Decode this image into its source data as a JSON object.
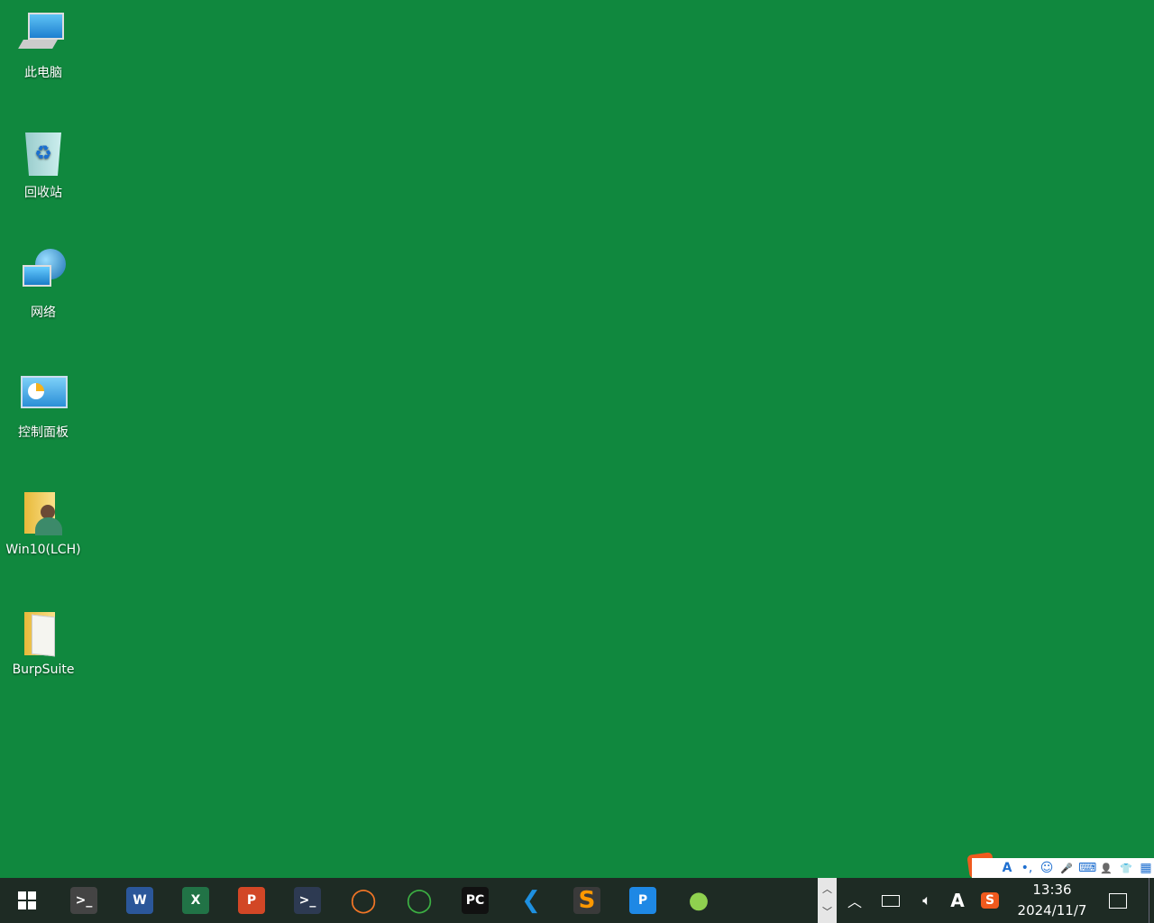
{
  "desktop": {
    "icons": [
      {
        "label": "此电脑",
        "icon": "computer-icon"
      },
      {
        "label": "回收站",
        "icon": "recycle-bin-icon"
      },
      {
        "label": "网络",
        "icon": "network-icon"
      },
      {
        "label": "控制面板",
        "icon": "control-panel-icon"
      },
      {
        "label": "Win10(LCH)",
        "icon": "user-folder-icon"
      },
      {
        "label": "BurpSuite",
        "icon": "folder-icon"
      }
    ]
  },
  "taskbar": {
    "apps": [
      {
        "name": "terminal-tool",
        "glyph": ">_",
        "color": "#444"
      },
      {
        "name": "word",
        "glyph": "W",
        "color": "#2b579a"
      },
      {
        "name": "excel",
        "glyph": "X",
        "color": "#217346"
      },
      {
        "name": "powerpoint",
        "glyph": "P",
        "color": "#d24726"
      },
      {
        "name": "powershell",
        "glyph": ">_",
        "color": "#2d3a52"
      },
      {
        "name": "jupyter",
        "glyph": "◯",
        "color": "transparent"
      },
      {
        "name": "circle-app",
        "glyph": "◯",
        "color": "transparent"
      },
      {
        "name": "pycharm",
        "glyph": "PC",
        "color": "#111"
      },
      {
        "name": "vscode",
        "glyph": "❮",
        "color": "transparent"
      },
      {
        "name": "sublime",
        "glyph": "S",
        "color": "#3a3a3a"
      },
      {
        "name": "p-app",
        "glyph": "P",
        "color": "#1e88e5"
      },
      {
        "name": "green-app",
        "glyph": "●",
        "color": "transparent"
      }
    ]
  },
  "ime": {
    "logo": "S",
    "items": [
      "A",
      "•,",
      "☺",
      "🎤",
      "⌨",
      "👤",
      "👕",
      "▦"
    ]
  },
  "tray": {
    "ime_letter": "A",
    "sogou": "S",
    "time": "13:36",
    "date": "2024/11/7"
  }
}
